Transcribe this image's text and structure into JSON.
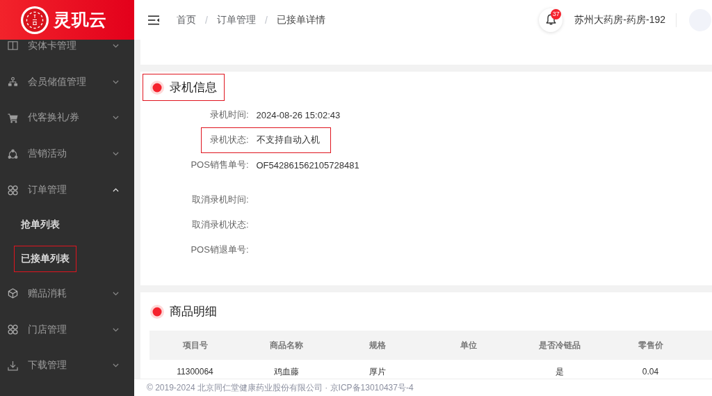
{
  "sidebar": {
    "logo": "灵玑云",
    "items": [
      {
        "label": "实体卡管理",
        "expanded": false
      },
      {
        "label": "会员储值管理",
        "expanded": false
      },
      {
        "label": "代客换礼/券",
        "expanded": false
      },
      {
        "label": "营销活动",
        "expanded": false
      },
      {
        "label": "订单管理",
        "expanded": true,
        "children": [
          {
            "label": "抢单列表",
            "highlighted": false
          },
          {
            "label": "已接单列表",
            "highlighted": true
          }
        ]
      },
      {
        "label": "赠品消耗",
        "expanded": false
      },
      {
        "label": "门店管理",
        "expanded": false
      },
      {
        "label": "下载管理",
        "expanded": false
      }
    ]
  },
  "header": {
    "breadcrumb": [
      {
        "label": "首页",
        "separator": "/"
      },
      {
        "label": "订单管理",
        "separator": "/"
      },
      {
        "label": "已接单详情"
      }
    ],
    "notifications": "37",
    "store": "苏州大药房-药房-192"
  },
  "record_section": {
    "title": "录机信息",
    "highlighted": true,
    "groups": [
      {
        "fields": [
          {
            "label": "录机时间:",
            "value": "2024-08-26 15:02:43",
            "highlighted": false
          },
          {
            "label": "录机状态:",
            "value": "不支持自动入机",
            "highlighted": true
          },
          {
            "label": "POS销售单号:",
            "value": "OF542861562105728481",
            "highlighted": false
          }
        ]
      },
      {
        "fields": [
          {
            "label": "取消录机时间:",
            "highlighted": false
          },
          {
            "label": "取消录机状态:",
            "highlighted": false
          },
          {
            "label": "POS销退单号:",
            "highlighted": false
          }
        ]
      }
    ]
  },
  "goods_section": {
    "title": "商品明细",
    "highlighted": false,
    "table": {
      "columns": [
        "项目号",
        "商品名称",
        "规格",
        "单位",
        "是否冷链品",
        "零售价"
      ],
      "rows": [
        {
          "cells": [
            "11300064",
            "鸡血藤",
            "厚片",
            null,
            "是",
            "0.04"
          ]
        }
      ]
    }
  },
  "footer": {
    "text": "© 2019-2024 北京同仁堂健康药业股份有限公司 · 京ICP备13010437号-4"
  }
}
